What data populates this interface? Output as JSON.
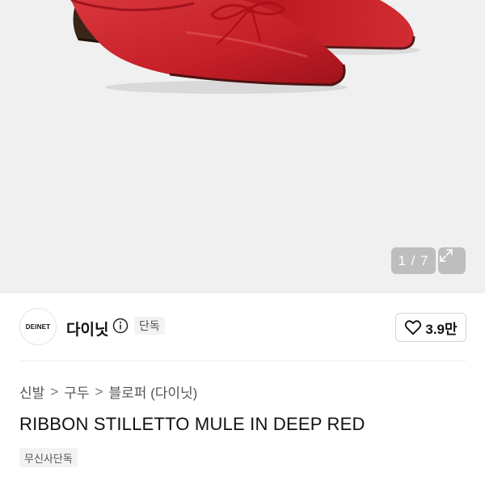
{
  "gallery": {
    "counter": "1 / 7",
    "image_icon": "red-pointed-mule-shoe",
    "expand_icon": "expand-icon"
  },
  "brand": {
    "logo_text": "DEINET",
    "name": "다이닛",
    "badge": "단독",
    "info_icon": "info-icon"
  },
  "like": {
    "icon": "heart-icon",
    "count": "3.9만"
  },
  "breadcrumb": {
    "items": [
      "신발",
      "구두",
      "블로퍼 (다이닛)"
    ],
    "separator": ">"
  },
  "product": {
    "title": "RIBBON STILLETTO MULE IN DEEP RED",
    "tag": "무신사단독"
  },
  "colors": {
    "shoe_red": "#c8232b",
    "image_bg": "#f0f0f0",
    "badge_bg": "#f2f3f5"
  }
}
